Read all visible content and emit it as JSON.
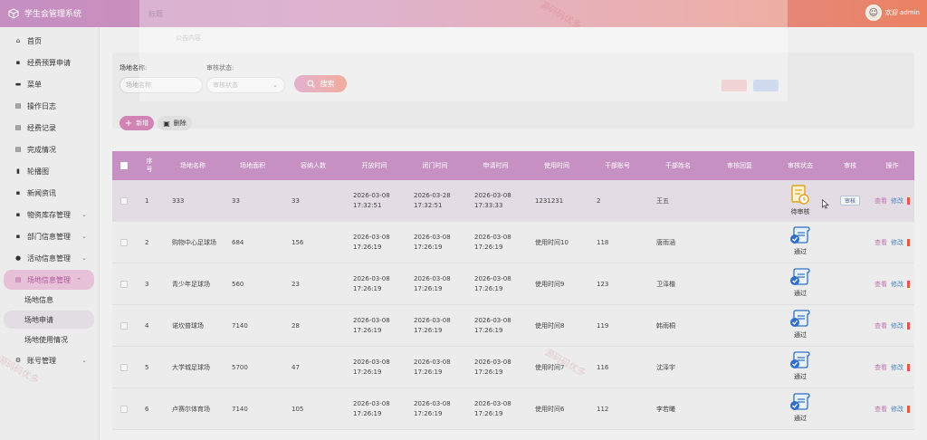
{
  "app": {
    "title": "学生会管理系统",
    "welcome": "欢迎 admin"
  },
  "sidebar": {
    "items": [
      {
        "label": "首页",
        "icon": "home-icon",
        "glyph": "⌂"
      },
      {
        "label": "经费预算申请",
        "icon": "budget-icon",
        "glyph": "▪"
      },
      {
        "label": "菜单",
        "icon": "menu-icon",
        "glyph": "▬"
      },
      {
        "label": "操作日志",
        "icon": "log-icon",
        "glyph": "▤"
      },
      {
        "label": "经费记录",
        "icon": "record-icon",
        "glyph": "▤"
      },
      {
        "label": "完成情况",
        "icon": "complete-icon",
        "glyph": "▤"
      },
      {
        "label": "轮播图",
        "icon": "carousel-icon",
        "glyph": "▮"
      },
      {
        "label": "新闻资讯",
        "icon": "news-icon",
        "glyph": "▪"
      },
      {
        "label": "物资库存管理",
        "icon": "inventory-icon",
        "glyph": "▪"
      },
      {
        "label": "部门信息管理",
        "icon": "dept-icon",
        "glyph": "▪"
      },
      {
        "label": "活动信息管理",
        "icon": "activity-icon",
        "glyph": "●"
      },
      {
        "label": "场地信息管理",
        "icon": "venue-icon",
        "glyph": "▤"
      }
    ],
    "sub_items": [
      "场地信息",
      "场地申请",
      "场地使用情况"
    ],
    "last_item": {
      "label": "账号管理",
      "icon": "account-icon",
      "glyph": "⚙"
    },
    "chevron": "⌄"
  },
  "overlay": {
    "title": "标题",
    "subtitle": "公告内容"
  },
  "search": {
    "venue_label": "场地名称:",
    "venue_placeholder": "场地名称",
    "status_label": "审核状态:",
    "status_placeholder": "审核状态",
    "button": "搜索"
  },
  "actions": {
    "add": "新增",
    "delete": "删除"
  },
  "table": {
    "headers": [
      "",
      "序号",
      "场地名称",
      "场地面积",
      "容纳人数",
      "开放时间",
      "闭门时间",
      "申请时间",
      "使用时间",
      "干部账号",
      "干部姓名",
      "审核回复",
      "审核状态",
      "审核",
      "操作"
    ],
    "rows": [
      {
        "no": "1",
        "name": "333",
        "area": "33",
        "capacity": "33",
        "open": "2026-03-08 17:32:51",
        "close": "2026-03-28 17:32:51",
        "apply": "2026-03-08 17:33:33",
        "use": "1231231",
        "account": "2",
        "cadre": "王五",
        "reply": "",
        "status": "待审核",
        "status_icon": "pending-audit-icon",
        "audit": "审核"
      },
      {
        "no": "2",
        "name": "购物中心足球场",
        "area": "684",
        "capacity": "156",
        "open": "2026-03-08 17:26:19",
        "close": "2026-03-08 17:26:19",
        "apply": "2026-03-08 17:26:19",
        "use": "使用时间10",
        "account": "118",
        "cadre": "唐雨涵",
        "reply": "",
        "status": "通过",
        "status_icon": "approved-icon",
        "audit": ""
      },
      {
        "no": "3",
        "name": "青少年足球场",
        "area": "560",
        "capacity": "23",
        "open": "2026-03-08 17:26:19",
        "close": "2026-03-08 17:26:19",
        "apply": "2026-03-08 17:26:19",
        "use": "使用时间9",
        "account": "123",
        "cadre": "卫泽楷",
        "reply": "",
        "status": "通过",
        "status_icon": "approved-icon",
        "audit": ""
      },
      {
        "no": "4",
        "name": "诺坎普球场",
        "area": "7140",
        "capacity": "28",
        "open": "2026-03-08 17:26:19",
        "close": "2026-03-08 17:26:19",
        "apply": "2026-03-08 17:26:19",
        "use": "使用时间8",
        "account": "119",
        "cadre": "韩雨桐",
        "reply": "",
        "status": "通过",
        "status_icon": "approved-icon",
        "audit": ""
      },
      {
        "no": "5",
        "name": "大学城足球场",
        "area": "5700",
        "capacity": "47",
        "open": "2026-03-08 17:26:19",
        "close": "2026-03-08 17:26:19",
        "apply": "2026-03-08 17:26:19",
        "use": "使用时间7",
        "account": "116",
        "cadre": "沈泽宇",
        "reply": "",
        "status": "通过",
        "status_icon": "approved-icon",
        "audit": ""
      },
      {
        "no": "6",
        "name": "卢赛尔体育场",
        "area": "7140",
        "capacity": "105",
        "open": "2026-03-08 17:26:19",
        "close": "2026-03-08 17:26:19",
        "apply": "2026-03-08 17:26:19",
        "use": "使用时间6",
        "account": "112",
        "cadre": "李若曦",
        "reply": "",
        "status": "通过",
        "status_icon": "approved-icon",
        "audit": ""
      }
    ],
    "ops": {
      "view": "查看",
      "edit": "修改"
    }
  },
  "watermark": "源码码优多",
  "colors": {
    "accent": "#c690c3",
    "header_gradient_end": "#eb8262",
    "view": "#c073b0",
    "edit": "#4a86c8",
    "delete": "#e05a4a"
  }
}
